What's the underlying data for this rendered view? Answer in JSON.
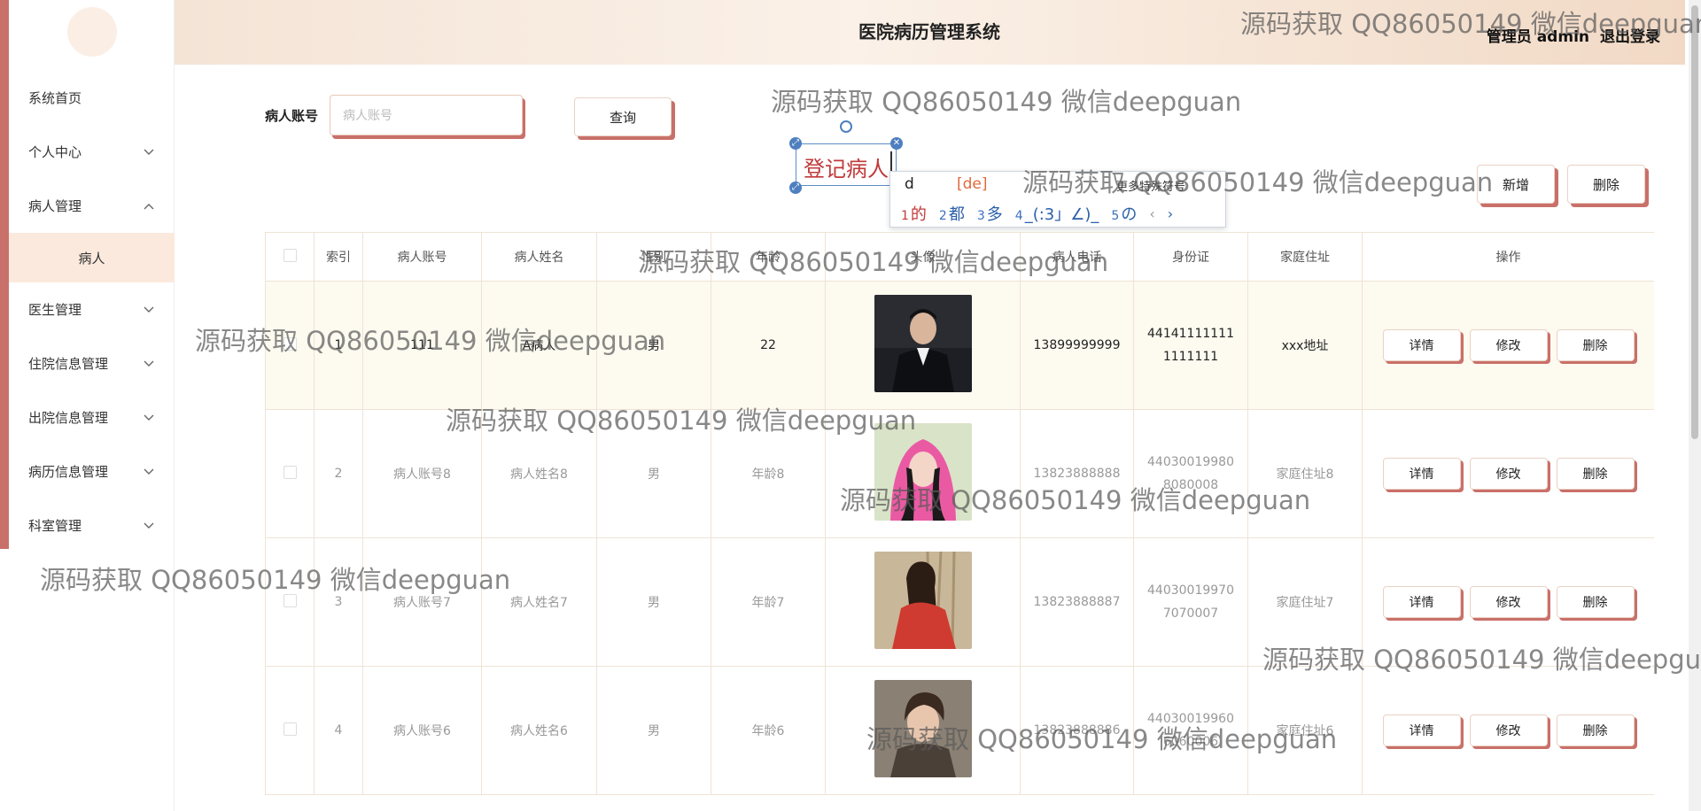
{
  "app": {
    "title": "医院病历管理系统",
    "user_label": "管理员 admin",
    "logout_label": "退出登录"
  },
  "sidebar": {
    "items": [
      {
        "label": "系统首页",
        "chevron": "none"
      },
      {
        "label": "个人中心",
        "chevron": "chevron-down-icon"
      },
      {
        "label": "病人管理",
        "chevron": "chevron-up-icon"
      },
      {
        "label": "病人",
        "sub": true
      },
      {
        "label": "医生管理",
        "chevron": "chevron-down-icon"
      },
      {
        "label": "住院信息管理",
        "chevron": "chevron-down-icon"
      },
      {
        "label": "出院信息管理",
        "chevron": "chevron-down-icon"
      },
      {
        "label": "病历信息管理",
        "chevron": "chevron-down-icon"
      },
      {
        "label": "科室管理",
        "chevron": "chevron-down-icon"
      }
    ]
  },
  "search": {
    "label": "病人账号",
    "placeholder": "病人账号",
    "query_label": "查询"
  },
  "editor": {
    "text": "登记病人",
    "ime_typed": "d",
    "ime_pinyin": "[de]",
    "ime_more": "更多特殊符号",
    "ime_candidates": [
      {
        "num": "1",
        "text": "的"
      },
      {
        "num": "2",
        "text": "都"
      },
      {
        "num": "3",
        "text": "多"
      },
      {
        "num": "4",
        "text": "_(:3」∠)_"
      },
      {
        "num": "5",
        "text": "の"
      }
    ],
    "ime_prev": "‹",
    "ime_next": "›"
  },
  "toolbar": {
    "add_label": "新增",
    "delete_label": "删除"
  },
  "table": {
    "headers": [
      "",
      "索引",
      "病人账号",
      "病人姓名",
      "性别",
      "年龄",
      "头像",
      "病人电话",
      "身份证",
      "家庭住址",
      "操作"
    ],
    "rows": [
      {
        "index": "1",
        "account": "111",
        "name": "A病人",
        "gender": "男",
        "age": "22",
        "phone": "13899999999",
        "id_line1": "44141111111",
        "id_line2": "1111111",
        "address": "xxx地址",
        "photo": "dark-suit-man"
      },
      {
        "index": "2",
        "account": "病人账号8",
        "name": "病人姓名8",
        "gender": "男",
        "age": "年龄8",
        "phone": "13823888888",
        "id_line1": "44030019980",
        "id_line2": "8080008",
        "address": "家庭住址8",
        "photo": "pink-hood-girl"
      },
      {
        "index": "3",
        "account": "病人账号7",
        "name": "病人姓名7",
        "gender": "男",
        "age": "年龄7",
        "phone": "13823888887",
        "id_line1": "44030019970",
        "id_line2": "7070007",
        "address": "家庭住址7",
        "photo": "red-dress-woman"
      },
      {
        "index": "4",
        "account": "病人账号6",
        "name": "病人姓名6",
        "gender": "男",
        "age": "年龄6",
        "phone": "13823888886",
        "id_line1": "44030019960",
        "id_line2": "6060006",
        "address": "家庭住址6",
        "photo": "young-man"
      }
    ],
    "action_labels": {
      "detail": "详情",
      "edit": "修改",
      "delete": "删除"
    }
  },
  "watermark": {
    "text": "源码获取 QQ86050149 微信deepguan"
  },
  "colors": {
    "accent": "#c9706a",
    "header_gradient_start": "#f4e4d6",
    "active_row": "#fdfaf0",
    "ime_highlight": "#c03a3a",
    "ime_pinyin": "#e06a3a"
  }
}
